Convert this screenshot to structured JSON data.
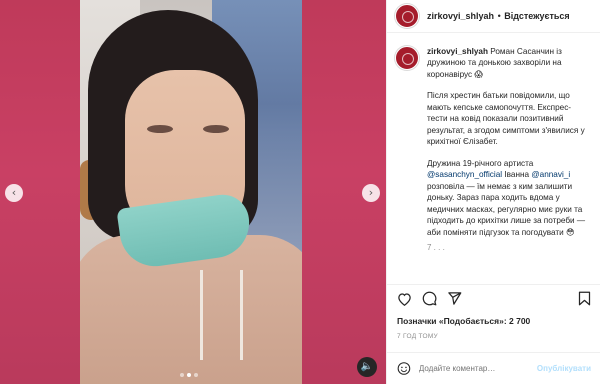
{
  "media": {
    "prev_glyph": "‹",
    "next_glyph": "›",
    "sound_glyph": "🔈",
    "dots_total": 3,
    "dots_active": 1
  },
  "post": {
    "username": "zirkovyi_shlyah",
    "separator": "•",
    "follow_label": "Відстежується"
  },
  "caption": {
    "username": "zirkovyi_shlyah",
    "intro": "Роман Сасанчин із дружиною та донькою захворіли на коронавірус 😱",
    "para2": "Після хрестин батьки повідомили, що мають кепське самопочуття. Експрес-тести на ковід показали позитивний результат, а згодом симптоми з'явилися у крихітної Єлізабет.",
    "para3_a": "Дружина 19-річного артиста",
    "mention1": "@sasanchyn_official",
    "para3_b": "Іванна",
    "mention2": "@annavi_i",
    "para3_c": "розповіла — їм немає з ким залишити доньку. Зараз пара ходить вдома у медичних масках, регулярно миє руки та підходить до крихітки лише за потреби — аби поміняти підгузок та погодувати 😳",
    "more": "7 . . ."
  },
  "actions": {
    "like_icon": "heart-icon",
    "comment_icon": "comment-icon",
    "share_icon": "share-icon",
    "save_icon": "bookmark-icon"
  },
  "likes_text": "Позначки «Подобається»: 2 700",
  "time_text": "7 ГОД ТОМУ",
  "comment": {
    "placeholder": "Додайте коментар…",
    "post_label": "Опублікувати"
  },
  "colors": {
    "media_bg": "#c43d5e",
    "avatar": "#a51c2b",
    "post_button": "#b2dffc"
  }
}
